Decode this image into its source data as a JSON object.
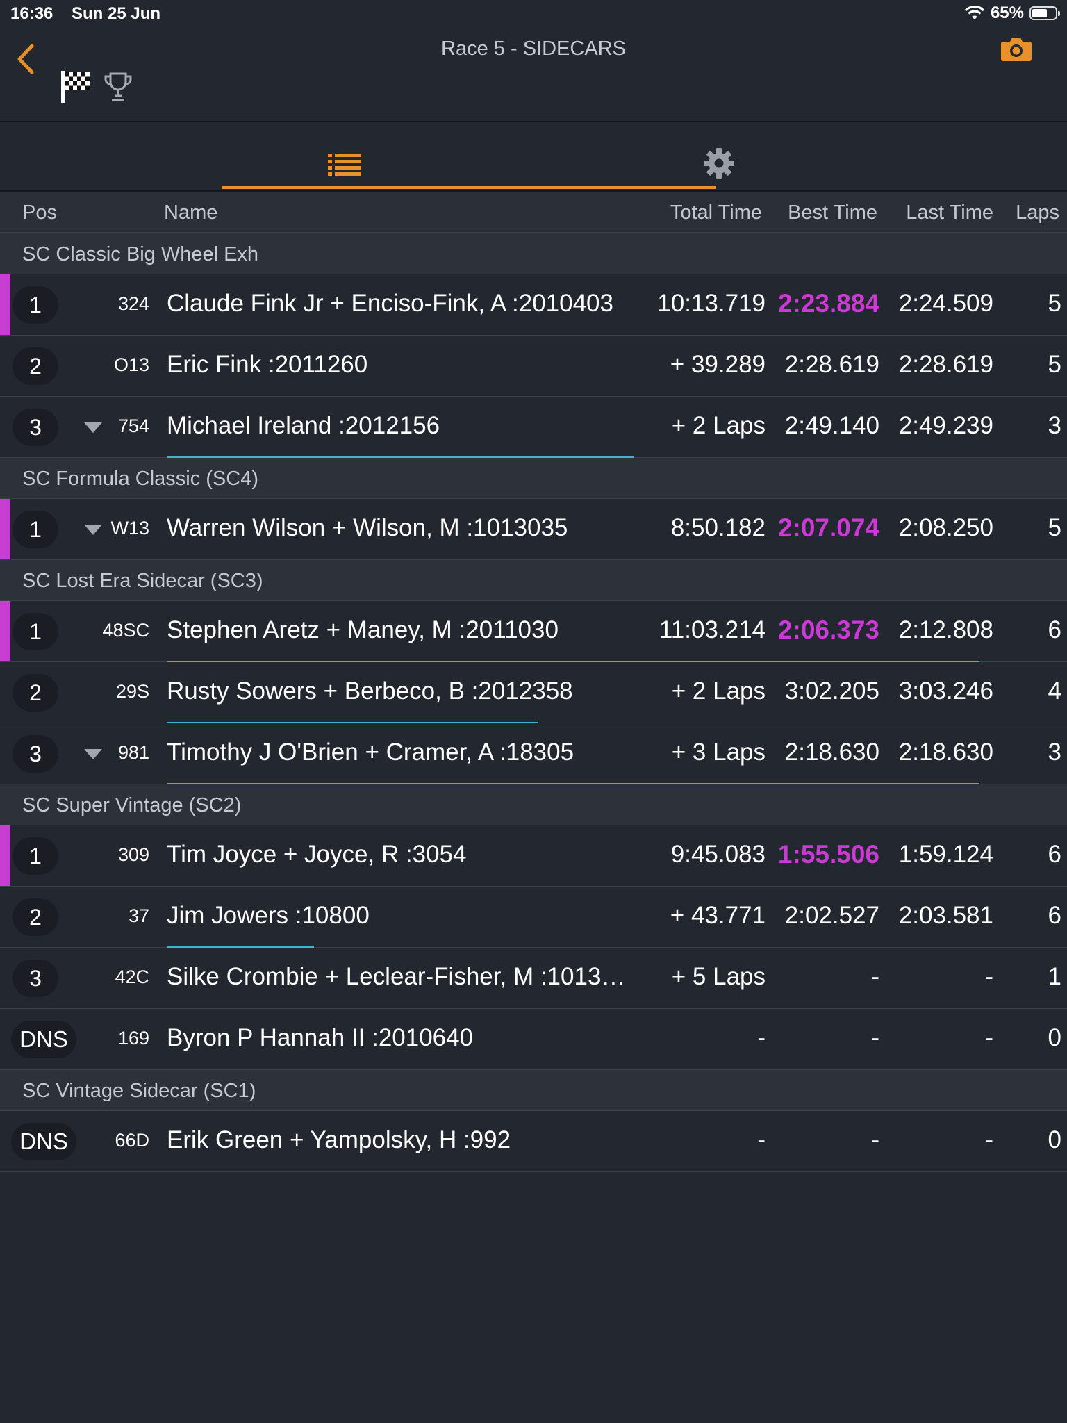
{
  "status_bar": {
    "time": "16:36",
    "date": "Sun 25 Jun",
    "battery": "65%",
    "battery_level": 0.65
  },
  "header": {
    "title": "Race 5 - SIDECARS"
  },
  "icons": {
    "back": "chevron-left-icon",
    "camera": "camera-icon",
    "flag": "checkered-flag-icon",
    "trophy": "trophy-icon",
    "list": "list-icon",
    "settings": "gear-icon"
  },
  "colors": {
    "accent": "#e8902a",
    "fastest": "#cc3ad6",
    "progress": "#3cb6c5",
    "background": "#23272f"
  },
  "columns": {
    "pos": "Pos",
    "name": "Name",
    "total": "Total Time",
    "best": "Best Time",
    "last": "Last Time",
    "laps": "Laps"
  },
  "groups": [
    {
      "title": "SC Classic Big Wheel Exh",
      "rows": [
        {
          "pos": "1",
          "num": "324",
          "name": "Claude Fink Jr + Enciso-Fink, A :2010403",
          "total": "10:13.719",
          "best": "2:23.884",
          "last": "2:24.509",
          "laps": "5",
          "leader": true,
          "fastest": true,
          "dropped": false,
          "progress": 0
        },
        {
          "pos": "2",
          "num": "O13",
          "name": "Eric Fink :2011260",
          "total": "+ 39.289",
          "best": "2:28.619",
          "last": "2:28.619",
          "laps": "5",
          "leader": false,
          "fastest": false,
          "dropped": false,
          "progress": 0
        },
        {
          "pos": "3",
          "num": "754",
          "name": "Michael Ireland :2012156",
          "total": "+ 2 Laps",
          "best": "2:49.140",
          "last": "2:49.239",
          "laps": "3",
          "leader": false,
          "fastest": false,
          "dropped": true,
          "progress": 0.54
        }
      ]
    },
    {
      "title": "SC Formula Classic (SC4)",
      "rows": [
        {
          "pos": "1",
          "num": "W13",
          "name": "Warren Wilson + Wilson, M :1013035",
          "total": "8:50.182",
          "best": "2:07.074",
          "last": "2:08.250",
          "laps": "5",
          "leader": true,
          "fastest": true,
          "dropped": true,
          "progress": 0
        }
      ]
    },
    {
      "title": "SC Lost Era Sidecar (SC3)",
      "rows": [
        {
          "pos": "1",
          "num": "48SC",
          "name": "Stephen Aretz + Maney, M :2011030",
          "total": "11:03.214",
          "best": "2:06.373",
          "last": "2:12.808",
          "laps": "6",
          "leader": true,
          "fastest": true,
          "dropped": false,
          "progress": 0.94
        },
        {
          "pos": "2",
          "num": "29S",
          "name": "Rusty Sowers + Berbeco, B :2012358",
          "total": "+ 2 Laps",
          "best": "3:02.205",
          "last": "3:03.246",
          "laps": "4",
          "leader": false,
          "fastest": false,
          "dropped": false,
          "progress": 0.43
        },
        {
          "pos": "3",
          "num": "981",
          "name": "Timothy J O'Brien + Cramer, A :18305",
          "total": "+ 3 Laps",
          "best": "2:18.630",
          "last": "2:18.630",
          "laps": "3",
          "leader": false,
          "fastest": false,
          "dropped": true,
          "progress": 0.94
        }
      ]
    },
    {
      "title": "SC Super Vintage (SC2)",
      "rows": [
        {
          "pos": "1",
          "num": "309",
          "name": "Tim Joyce + Joyce, R :3054",
          "total": "9:45.083",
          "best": "1:55.506",
          "last": "1:59.124",
          "laps": "6",
          "leader": true,
          "fastest": true,
          "dropped": false,
          "progress": 0
        },
        {
          "pos": "2",
          "num": "37",
          "name": "Jim Jowers :10800",
          "total": "+ 43.771",
          "best": "2:02.527",
          "last": "2:03.581",
          "laps": "6",
          "leader": false,
          "fastest": false,
          "dropped": false,
          "progress": 0.17
        },
        {
          "pos": "3",
          "num": "42C",
          "name": "Silke Crombie + Leclear-Fisher, M :1013…",
          "total": "+ 5 Laps",
          "best": "-",
          "last": "-",
          "laps": "1",
          "leader": false,
          "fastest": false,
          "dropped": false,
          "progress": 0
        },
        {
          "pos": "DNS",
          "num": "169",
          "name": "Byron P Hannah II :2010640",
          "total": "-",
          "best": "-",
          "last": "-",
          "laps": "0",
          "leader": false,
          "fastest": false,
          "dropped": false,
          "progress": 0
        }
      ]
    },
    {
      "title": "SC Vintage Sidecar (SC1)",
      "rows": [
        {
          "pos": "DNS",
          "num": "66D",
          "name": "Erik Green + Yampolsky, H :992",
          "total": "-",
          "best": "-",
          "last": "-",
          "laps": "0",
          "leader": false,
          "fastest": false,
          "dropped": false,
          "progress": 0
        }
      ]
    }
  ]
}
